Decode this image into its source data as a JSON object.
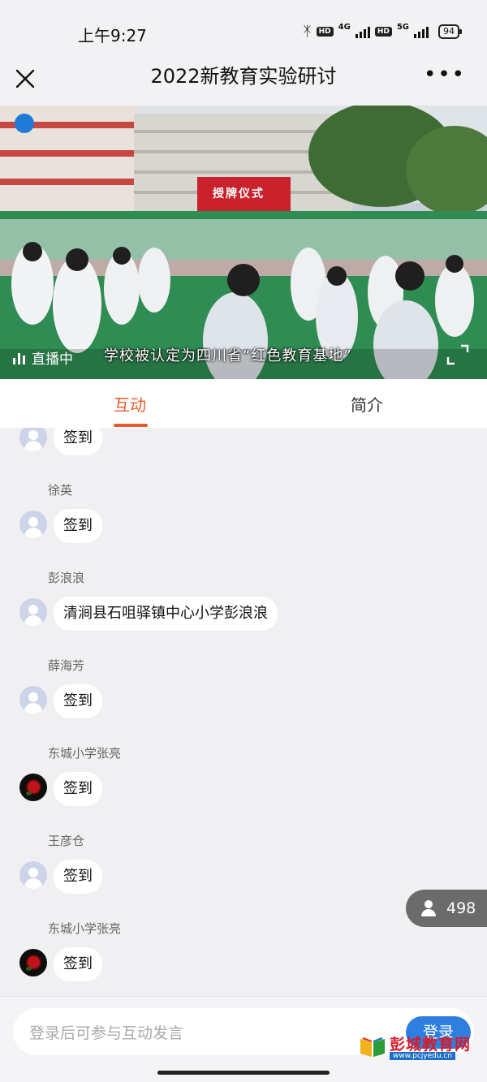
{
  "status_bar": {
    "time": "上午9:27",
    "hd1": "HD",
    "net1": "4G",
    "hd2": "HD",
    "net2": "5G",
    "battery": "94"
  },
  "nav": {
    "title": "2022新教育实验研讨"
  },
  "video": {
    "live_label": "直播中",
    "subtitle": "学校被认定为四川省“红色教育基地”",
    "banner_text": "授牌仪式"
  },
  "tabs": [
    {
      "label": "互动",
      "active": true
    },
    {
      "label": "简介",
      "active": false
    }
  ],
  "messages": [
    {
      "name": "",
      "text": "签到",
      "avatar": "default"
    },
    {
      "name": "徐英",
      "text": "签到",
      "avatar": "default"
    },
    {
      "name": "彭浪浪",
      "text": "清涧县石咀驿镇中心小学彭浪浪",
      "avatar": "default"
    },
    {
      "name": "薛海芳",
      "text": "签到",
      "avatar": "default"
    },
    {
      "name": "东城小学张亮",
      "text": "签到",
      "avatar": "rose"
    },
    {
      "name": "王彦仓",
      "text": "签到",
      "avatar": "default"
    },
    {
      "name": "东城小学张亮",
      "text": "签到",
      "avatar": "rose"
    }
  ],
  "online": {
    "count": "498"
  },
  "input": {
    "placeholder": "登录后可参与互动发言",
    "login_label": "登录"
  },
  "watermark": {
    "text": "彭城教育网",
    "url": "www.pcjyedu.cn"
  },
  "colors": {
    "accent": "#e85a2d",
    "button": "#2f7fe0"
  }
}
